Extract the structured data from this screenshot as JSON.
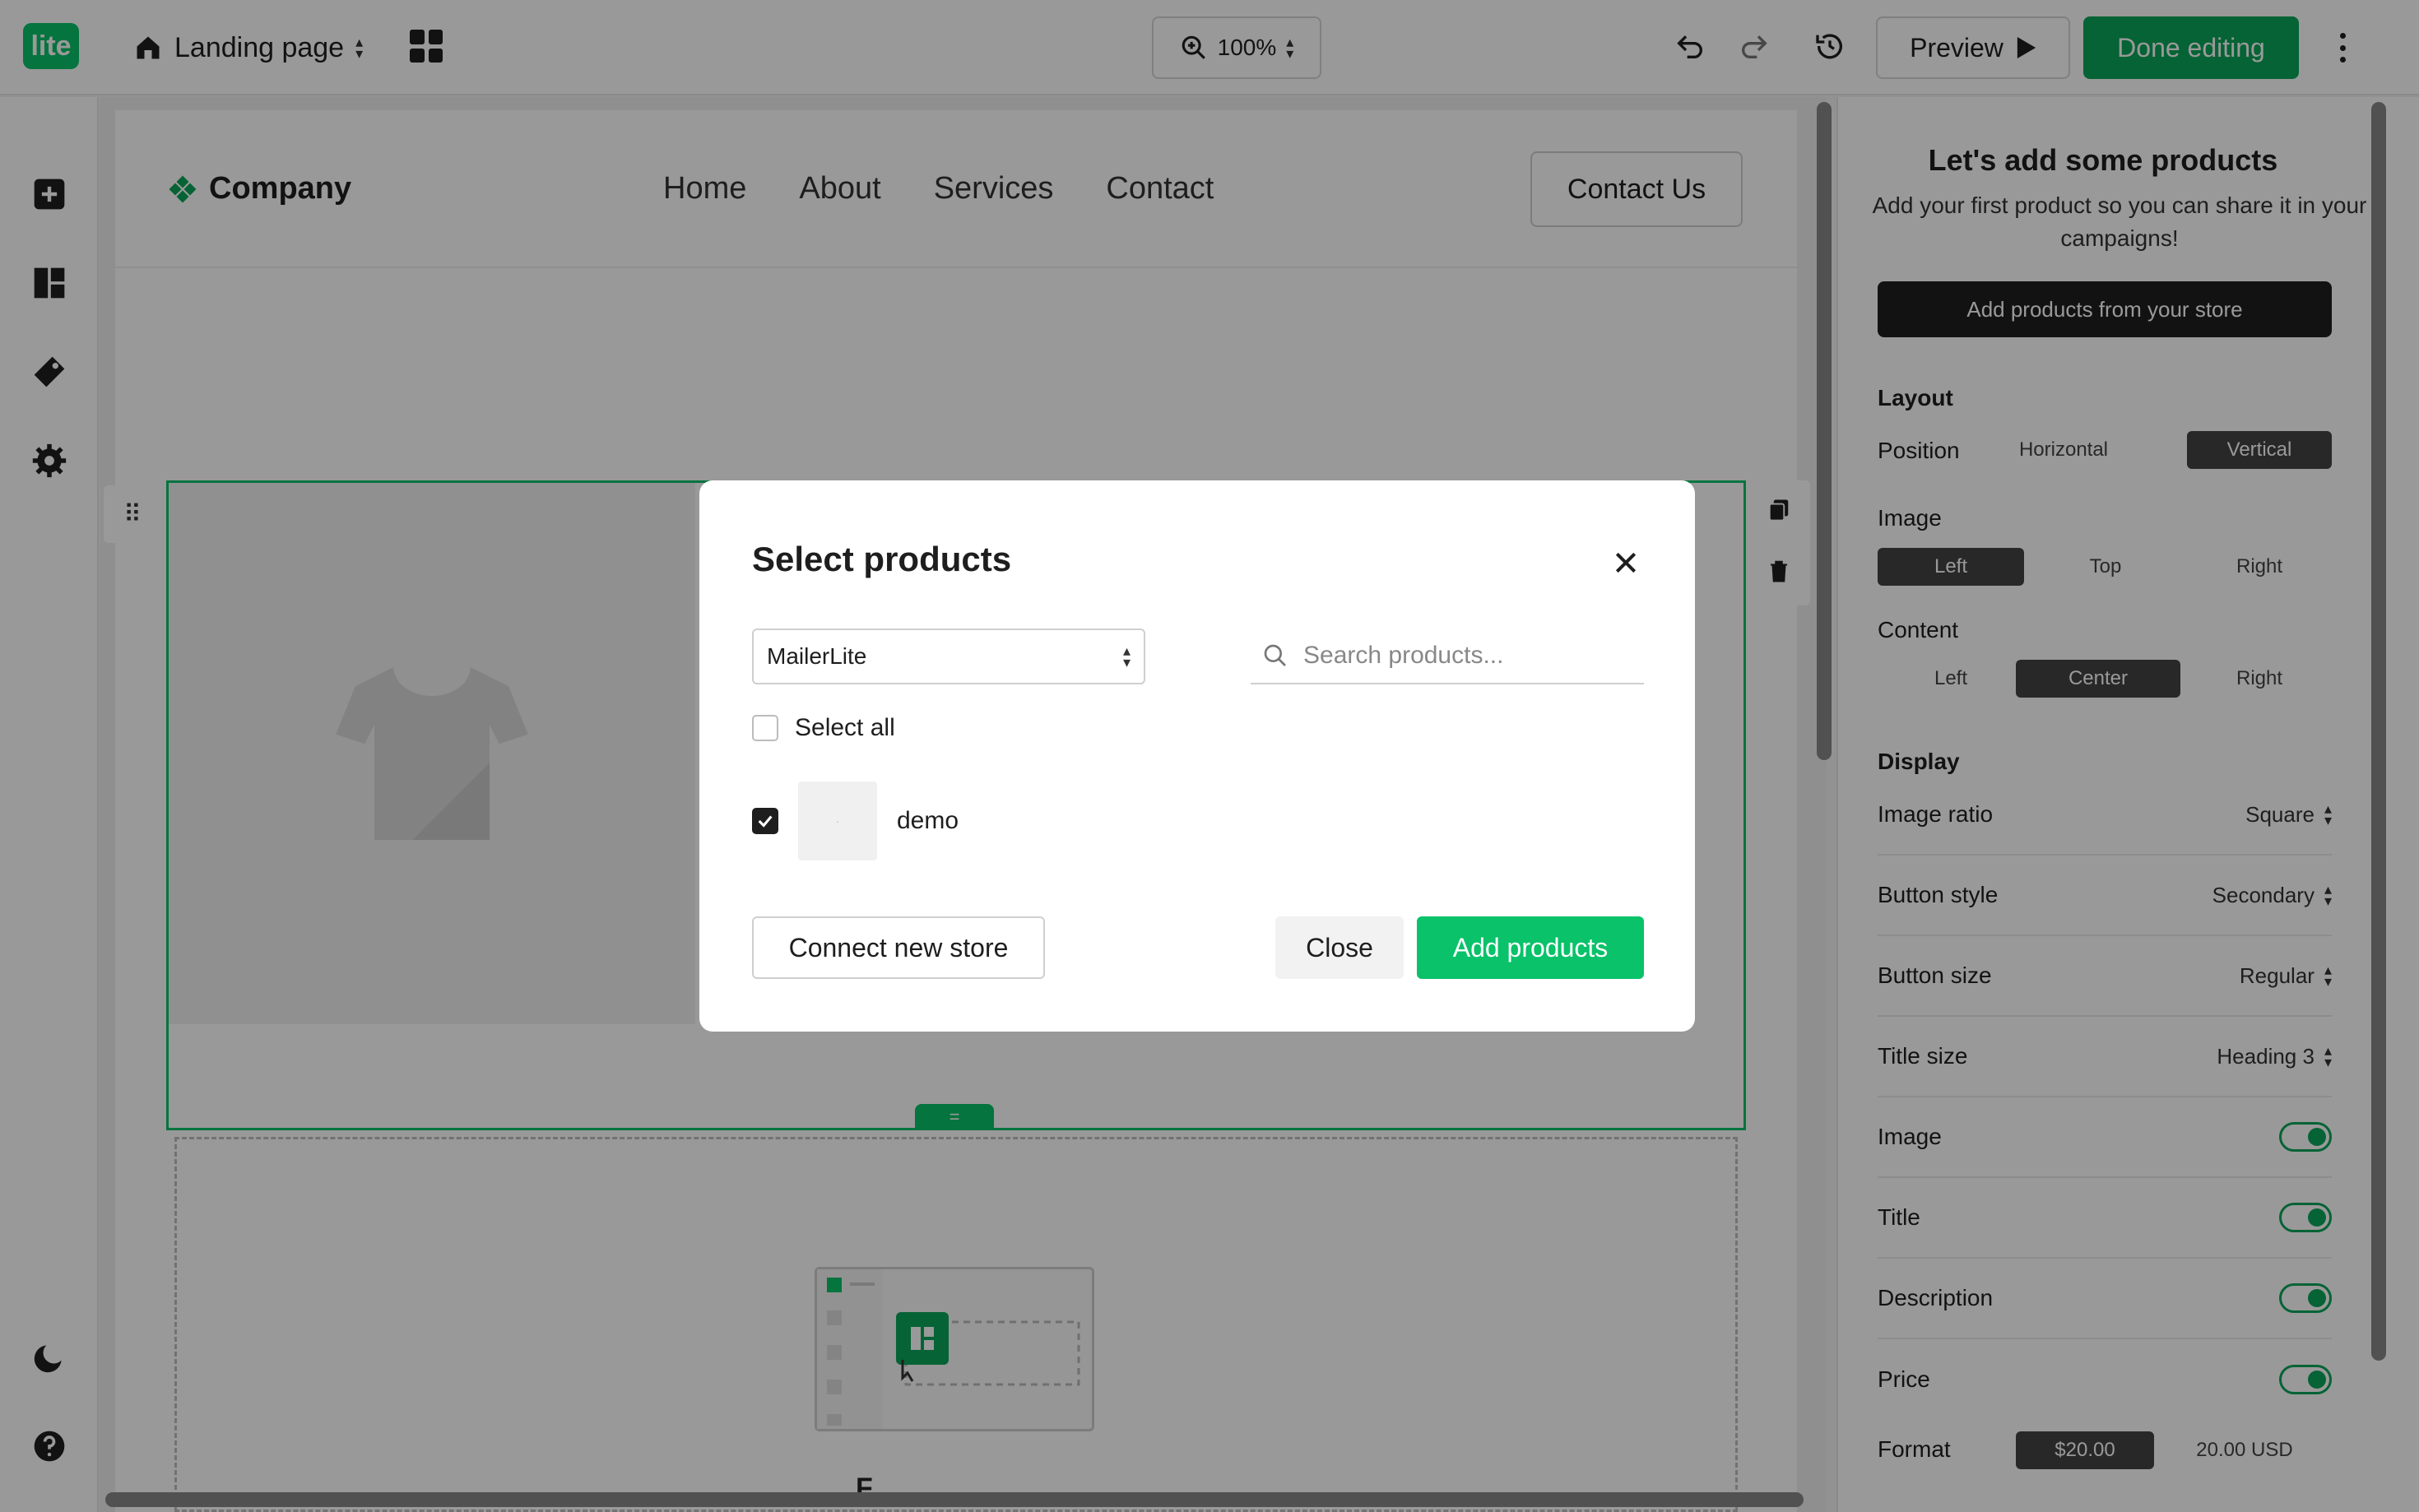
{
  "app": {
    "logo_text": "lite",
    "brand_color": "#09c269",
    "page_name": "Landing page",
    "zoom": "100%",
    "preview_label": "Preview",
    "done_label": "Done editing"
  },
  "left_rail": {
    "items": [
      "add-block-icon",
      "layout-icon",
      "style-icon",
      "settings-icon"
    ],
    "bottom": [
      "dark-mode-icon",
      "help-icon"
    ]
  },
  "site": {
    "company": "Company",
    "nav": [
      "Home",
      "About",
      "Services",
      "Contact"
    ],
    "cta": "Contact Us",
    "partial_heading": "F"
  },
  "right_panel": {
    "title": "Let's add some products",
    "subtitle": "Add your first product so you can share it in your campaigns!",
    "store_button": "Add products from your store",
    "layout_section": "Layout",
    "position_label": "Position",
    "position_options": [
      "Horizontal",
      "Vertical"
    ],
    "position_selected": "Vertical",
    "image_label": "Image",
    "image_options": [
      "Left",
      "Top",
      "Right"
    ],
    "image_selected": "Left",
    "content_label": "Content",
    "content_options": [
      "Left",
      "Center",
      "Right"
    ],
    "content_selected": "Center",
    "display_section": "Display",
    "dropdowns": [
      {
        "label": "Image ratio",
        "value": "Square"
      },
      {
        "label": "Button style",
        "value": "Secondary"
      },
      {
        "label": "Button size",
        "value": "Regular"
      },
      {
        "label": "Title size",
        "value": "Heading 3"
      }
    ],
    "toggles": [
      {
        "label": "Image",
        "on": true
      },
      {
        "label": "Title",
        "on": true
      },
      {
        "label": "Description",
        "on": true
      },
      {
        "label": "Price",
        "on": true
      }
    ],
    "format_label": "Format",
    "format_options": [
      "$20.00",
      "20.00 USD"
    ],
    "format_selected": "$20.00"
  },
  "modal": {
    "title": "Select products",
    "store_value": "MailerLite",
    "search_placeholder": "Search products...",
    "select_all_label": "Select all",
    "select_all_checked": false,
    "products": [
      {
        "name": "demo",
        "checked": true
      }
    ],
    "connect_label": "Connect new store",
    "close_label": "Close",
    "add_label": "Add products"
  }
}
